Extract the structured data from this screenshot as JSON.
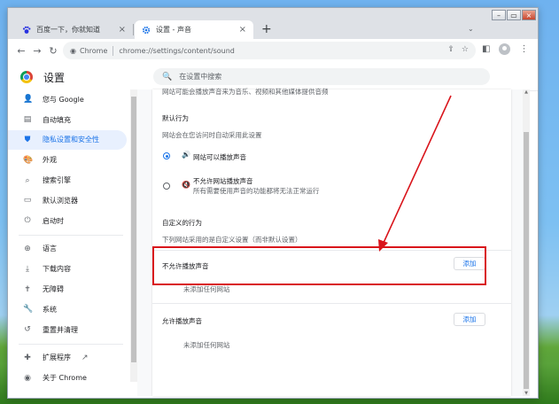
{
  "tabs": [
    {
      "title": "百度一下，你就知道",
      "close": "×",
      "icon": "paw-icon"
    },
    {
      "title": "设置 - 声音",
      "close": "×",
      "icon": "gear-icon"
    }
  ],
  "new_tab": "+",
  "tab_search": "⌄",
  "window_controls": [
    "–",
    "▭",
    "×"
  ],
  "toolbar": {
    "back": "←",
    "forward": "→",
    "reload": "↻",
    "chip": "Chrome",
    "url": "chrome://settings/content/sound",
    "share": "⇪",
    "bookmark": "☆",
    "panel": "◧",
    "menu": "⋮"
  },
  "header": {
    "title": "设置",
    "search_placeholder": "在设置中搜索",
    "search_icon": "🔍"
  },
  "sidebar": {
    "items": [
      {
        "label": "您与 Google",
        "icon": "person-icon",
        "glyph": "👤"
      },
      {
        "label": "自动填充",
        "icon": "clipboard-icon",
        "glyph": "▤"
      },
      {
        "label": "隐私设置和安全性",
        "icon": "shield-icon",
        "glyph": "⛊"
      },
      {
        "label": "外观",
        "icon": "palette-icon",
        "glyph": "🎨"
      },
      {
        "label": "搜索引擎",
        "icon": "search-icon",
        "glyph": "⌕"
      },
      {
        "label": "默认浏览器",
        "icon": "browser-icon",
        "glyph": "▭"
      },
      {
        "label": "启动时",
        "icon": "power-icon",
        "glyph": "⏻"
      },
      {
        "label": "语言",
        "icon": "globe-icon",
        "glyph": "⊕"
      },
      {
        "label": "下载内容",
        "icon": "download-icon",
        "glyph": "⤓"
      },
      {
        "label": "无障碍",
        "icon": "accessibility-icon",
        "glyph": "✝"
      },
      {
        "label": "系统",
        "icon": "wrench-icon",
        "glyph": "🔧"
      },
      {
        "label": "重置并清理",
        "icon": "reset-icon",
        "glyph": "↺"
      },
      {
        "label": "扩展程序",
        "icon": "puzzle-icon",
        "glyph": "✚"
      },
      {
        "label": "关于 Chrome",
        "icon": "chrome-icon",
        "glyph": "◉"
      }
    ],
    "external_icon": "↗"
  },
  "content": {
    "top_note": "网站可能会播放声音来为音乐、视频和其他媒体提供音频",
    "default_heading": "默认行为",
    "default_desc": "网站会在您访问时自动采用此设置",
    "options": [
      {
        "label": "网站可以播放声音",
        "sublabel": "",
        "selected": true,
        "icon": "speaker-icon",
        "glyph": "🔊"
      },
      {
        "label": "不允许网站播放声音",
        "sublabel": "所有需要使用声音的功能都将无法正常运行",
        "selected": false,
        "icon": "speaker-muted-icon",
        "glyph": "🔇"
      }
    ],
    "custom_heading": "自定义的行为",
    "custom_desc": "下列网站采用的是自定义设置（而非默认设置）",
    "block_section": {
      "title": "不允许播放声音",
      "add": "添加",
      "empty": "未添加任何网站"
    },
    "allow_section": {
      "title": "允许播放声音",
      "add": "添加",
      "empty": "未添加任何网站"
    }
  },
  "colors": {
    "accent": "#1a73e8",
    "annotation": "#d9141b"
  }
}
